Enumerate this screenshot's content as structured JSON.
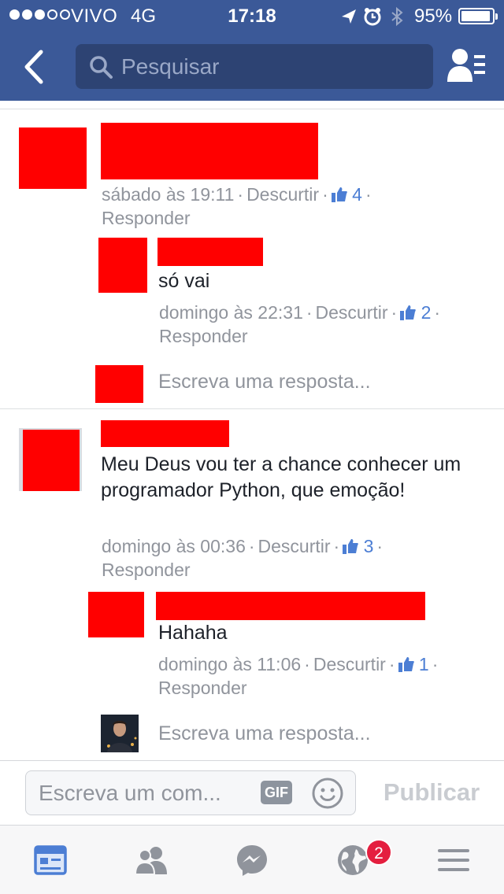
{
  "status_bar": {
    "carrier": "VIVO",
    "network": "4G",
    "time": "17:18",
    "battery_percent": "95%",
    "battery_level": 0.95
  },
  "header": {
    "search_placeholder": "Pesquisar"
  },
  "comments": [
    {
      "text": "",
      "time": "sábado às 19:11",
      "unlike_label": "Descurtir",
      "likes": "4",
      "reply_label": "Responder",
      "replies": [
        {
          "text": "só vai",
          "time": "domingo às 22:31",
          "unlike_label": "Descurtir",
          "likes": "2",
          "reply_label": "Responder"
        }
      ],
      "reply_prompt": "Escreva uma resposta..."
    },
    {
      "text": "Meu Deus vou ter a chance  conhecer um programador Python, que emoção!",
      "time": "domingo às 00:36",
      "unlike_label": "Descurtir",
      "likes": "3",
      "reply_label": "Responder",
      "replies": [
        {
          "text": "Hahaha",
          "time": "domingo às 11:06",
          "unlike_label": "Descurtir",
          "likes": "1",
          "reply_label": "Responder"
        }
      ],
      "reply_prompt": "Escreva uma resposta..."
    }
  ],
  "compose": {
    "placeholder": "Escreva um com...",
    "gif_label": "GIF",
    "publish_label": "Publicar"
  },
  "tab_bar": {
    "notifications_badge": "2"
  },
  "colors": {
    "brand": "#3b5998",
    "like": "#4c7ed4",
    "badge": "#e41e3f"
  }
}
